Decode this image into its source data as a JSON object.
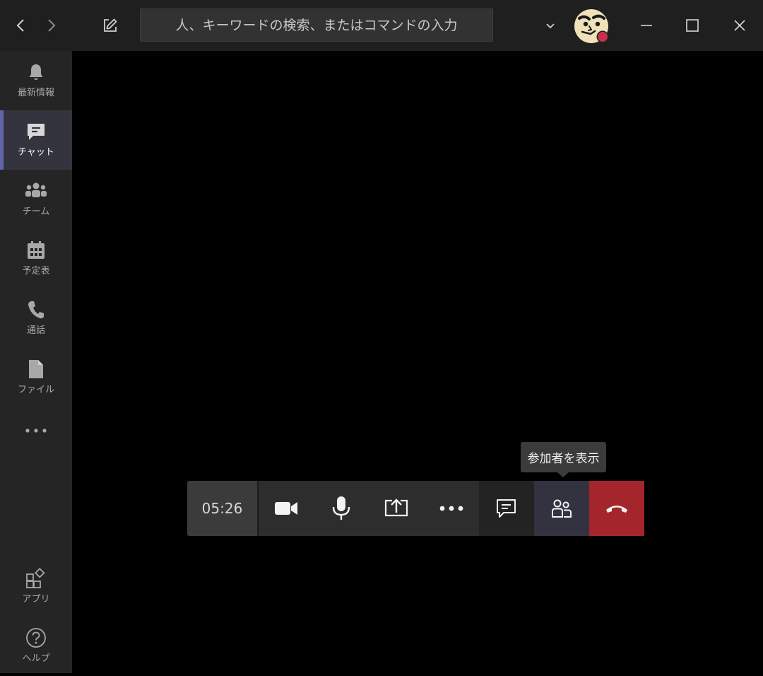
{
  "titlebar": {
    "search_placeholder": "人、キーワードの検索、またはコマンドの入力",
    "back_icon": "chevron-left-icon",
    "forward_icon": "chevron-right-icon",
    "compose_icon": "compose-icon",
    "dropdown_icon": "chevron-down-icon",
    "minimize_icon": "minimize-icon",
    "maximize_icon": "maximize-icon",
    "close_icon": "close-icon",
    "presence_color": "#c4314b"
  },
  "sidebar": {
    "items": [
      {
        "label": "最新情報",
        "icon": "bell-icon",
        "active": false
      },
      {
        "label": "チャット",
        "icon": "chat-icon",
        "active": true
      },
      {
        "label": "チーム",
        "icon": "teams-icon",
        "active": false
      },
      {
        "label": "予定表",
        "icon": "calendar-icon",
        "active": false
      },
      {
        "label": "通話",
        "icon": "phone-icon",
        "active": false
      },
      {
        "label": "ファイル",
        "icon": "file-icon",
        "active": false
      }
    ],
    "more_icon": "more-icon",
    "bottom_items": [
      {
        "label": "アプリ",
        "icon": "apps-icon"
      },
      {
        "label": "ヘルプ",
        "icon": "help-icon"
      }
    ]
  },
  "call": {
    "timer": "05:26",
    "tooltip": "参加者を表示",
    "controls": [
      "video-icon",
      "mic-icon",
      "share-screen-icon",
      "more-options-icon",
      "chat-icon",
      "participants-icon",
      "hang-up-icon"
    ],
    "accent_color": "#6264a7",
    "hangup_color": "#a4262c"
  }
}
